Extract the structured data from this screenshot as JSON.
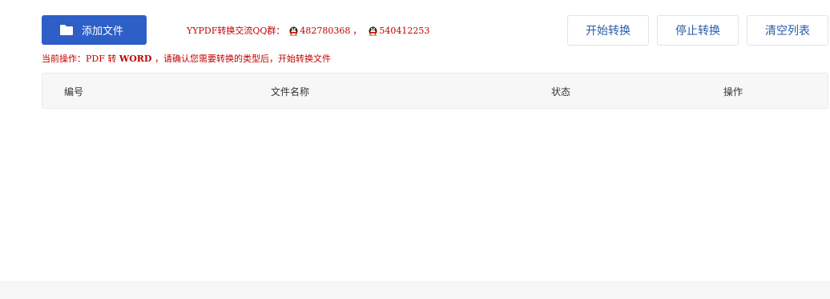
{
  "colors": {
    "primary": "#2d5fc6",
    "accent_text": "#c00000",
    "button_text": "#2a5ba8"
  },
  "toolbar": {
    "add_files_label": "添加文件",
    "start_label": "开始转换",
    "stop_label": "停止转换",
    "clear_label": "清空列表"
  },
  "qq_group": {
    "prefix": "YYPDF转换交流QQ群：",
    "number_1": "482780368",
    "separator": "，",
    "number_2": "540412253",
    "icon": "qq-penguin-icon"
  },
  "operation": {
    "prefix": "当前操作：PDF 转 ",
    "target": "WORD",
    "suffix": " ，请确认您需要转换的类型后，开始转换文件"
  },
  "table": {
    "columns": [
      "编号",
      "文件名称",
      "状态",
      "操作"
    ]
  }
}
